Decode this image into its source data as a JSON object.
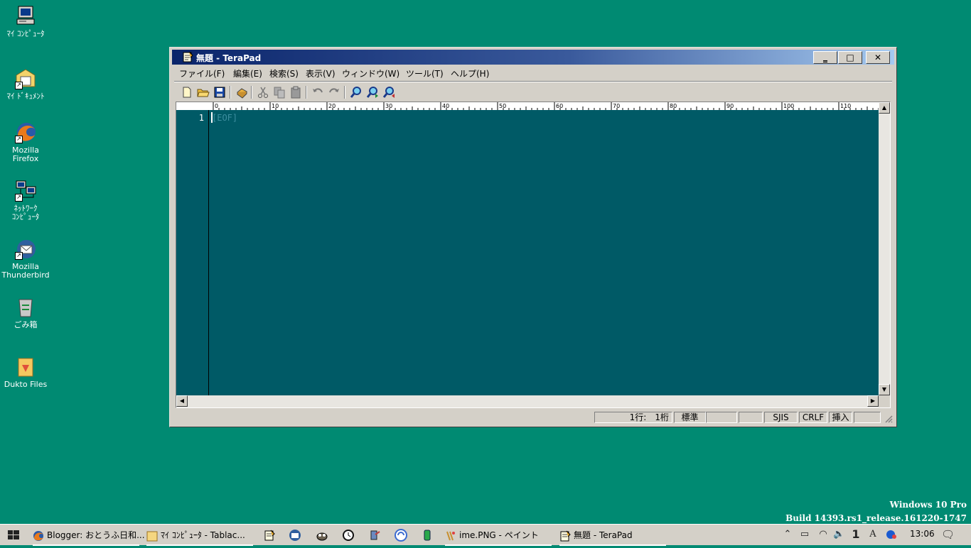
{
  "desktop": {
    "icons": [
      {
        "label": "ﾏｲ ｺﾝﾋﾟｭｰﾀ",
        "icon": "computer-icon"
      },
      {
        "label": "ﾏｲ ﾄﾞｷｭﾒﾝﾄ",
        "icon": "documents-folder-icon"
      },
      {
        "label": "Mozilla\nFirefox",
        "icon": "firefox-icon"
      },
      {
        "label": "ﾈｯﾄﾜｰｸ\nｺﾝﾋﾟｭｰﾀ",
        "icon": "network-icon"
      },
      {
        "label": "Mozilla\nThunderbird",
        "icon": "thunderbird-icon"
      },
      {
        "label": "ごみ箱",
        "icon": "recycle-bin-icon"
      },
      {
        "label": "Dukto Files",
        "icon": "folder-icon"
      }
    ]
  },
  "window": {
    "title": "無題 - TeraPad",
    "caption_buttons": {
      "minimize": "‗",
      "maximize": "□",
      "close": "✕"
    },
    "menu": [
      "ファイル(F)",
      "編集(E)",
      "検索(S)",
      "表示(V)",
      "ウィンドウ(W)",
      "ツール(T)",
      "ヘルプ(H)"
    ],
    "toolbar": [
      "new-file-icon",
      "open-folder-icon",
      "save-icon",
      "print-icon",
      "cut-icon",
      "copy-icon",
      "paste-icon",
      "undo-icon",
      "redo-icon",
      "find-icon",
      "find-next-icon",
      "find-prev-icon"
    ],
    "ruler_labels": [
      "0",
      "10",
      "20",
      "30",
      "40",
      "50",
      "60",
      "70",
      "80",
      "90",
      "100",
      "110"
    ],
    "editor": {
      "line_number": "1",
      "eof_marker": "[EOF]"
    },
    "statusbar": {
      "position": "1行:　1桁",
      "mode": "標準",
      "blank1": "",
      "blank2": "",
      "encoding": "SJIS",
      "newline": "CRLF",
      "insert": "挿入",
      "blank3": ""
    },
    "colors": {
      "editor_bg": "#005a66",
      "title_start": "#0a246a",
      "title_end": "#a6caf0"
    }
  },
  "watermark": {
    "line1": "Windows 10 Pro",
    "line2": "Build 14393.rs1_release.161220-1747"
  },
  "taskbar": {
    "buttons": [
      {
        "label": "Blogger: おとうふ日和...",
        "icon": "firefox-icon"
      },
      {
        "label": "ﾏｲ ｺﾝﾋﾟｭｰﾀ - Tablac...",
        "icon": "folder-icon"
      },
      {
        "label": "ime.PNG - ペイント",
        "icon": "paint-icon"
      },
      {
        "label": "無題 - TeraPad",
        "icon": "terapad-icon"
      }
    ],
    "clock": "13:06",
    "ime_indicator": "1",
    "ime_mode": "A"
  }
}
